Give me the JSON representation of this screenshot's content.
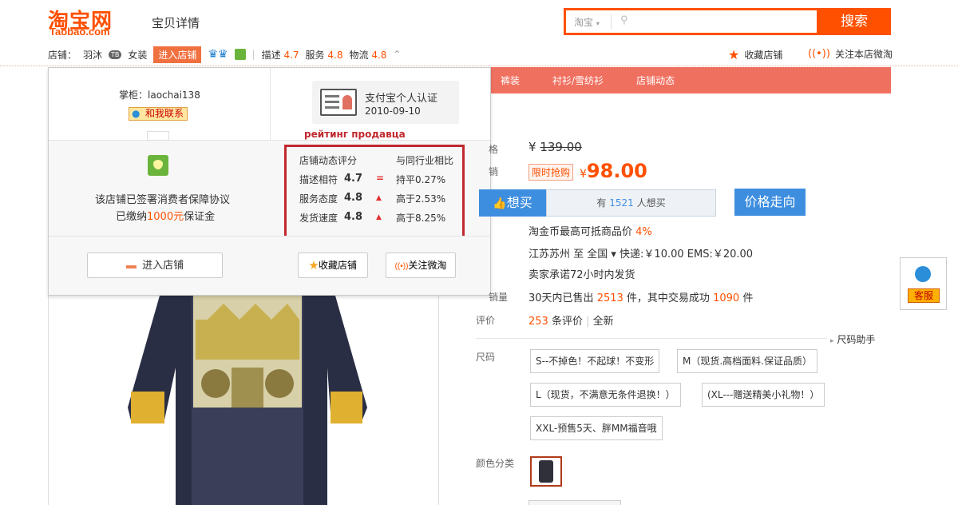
{
  "header": {
    "logo": "淘宝网",
    "logo_sub": "Taobao.com",
    "page_title": "宝贝详情",
    "search_scope": "淘宝",
    "search_button": "搜索"
  },
  "shop_bar": {
    "shop_label": "店铺：",
    "shop_name": "羽沐",
    "shop_tag": "TB",
    "category": "女装",
    "enter_shop": "进入店铺",
    "scores": [
      {
        "label": "描述",
        "value": "4.7"
      },
      {
        "label": "服务",
        "value": "4.8"
      },
      {
        "label": "物流",
        "value": "4.8"
      }
    ],
    "favorite_store": "收藏店铺",
    "follow_store": "关注本店微淘"
  },
  "nav_tabs": [
    "裤装",
    "衬衫/雪纺衫",
    "店铺动态"
  ],
  "popup": {
    "keeper": "掌柜：laochai138",
    "contact": "和我联系",
    "alipay_title": "支付宝个人认证",
    "alipay_date": "2010-09-10",
    "seller_rating_caption": "рейтинг продавца",
    "guarantee_line1": "该店铺已签署消费者保障协议",
    "guarantee_line2_pre": "已缴纳",
    "guarantee_amount": "1000元",
    "guarantee_line2_post": "保证金",
    "rating_header_left": "店铺动态评分",
    "rating_header_right": "与同行业相比",
    "ratings": [
      {
        "label": "描述相符",
        "value": "4.7",
        "indicator": "=",
        "compare": "持平0.27%"
      },
      {
        "label": "服务态度",
        "value": "4.8",
        "indicator": "▲",
        "compare": "高于2.53%"
      },
      {
        "label": "发货速度",
        "value": "4.8",
        "indicator": "▲",
        "compare": "高于8.25%"
      }
    ],
    "enter_shop_button": "进入店铺",
    "favorite_button": "收藏店铺",
    "follow_button": "关注微淘"
  },
  "product": {
    "orig_price_currency": "¥",
    "orig_price": "139.00",
    "promo_tag": "限时抢购",
    "promo_currency": "¥",
    "promo_price": "98.00",
    "want_button": "想买",
    "want_count_pre": "有",
    "want_count": "1521",
    "want_count_post": "人想买",
    "price_trend_button": "价格走向",
    "taojinbi_pre": "淘金币最高可抵商品价",
    "taojinbi_pct": "4%",
    "shipping": "江苏苏州 至  全国 ▾   快递:￥10.00   EMS:￥20.00",
    "ship_promise": "卖家承诺72小时内发货",
    "sold_pre": "30天内已售出",
    "sold_count": "2513",
    "sold_mid": "件，其中交易成功",
    "success_count": "1090",
    "sold_post": "件",
    "sales_label": "销量",
    "reviews_label": "评价",
    "reviews_count": "253",
    "reviews_text": "条评价",
    "reviews_sep": "|",
    "reviews_new": "全新",
    "size_helper": "尺码助手",
    "size_label": "尺码",
    "sizes": [
      "S--不掉色！不起球！不变形",
      "M（现货.高档面料.保证品质）",
      "L（现货，不满意无条件退换！）",
      "(XL---赠送精美小礼物！）",
      "XXL-预售5天、胖MM福音哦"
    ],
    "color_label": "颜色分类"
  },
  "customer_service": "客服"
}
